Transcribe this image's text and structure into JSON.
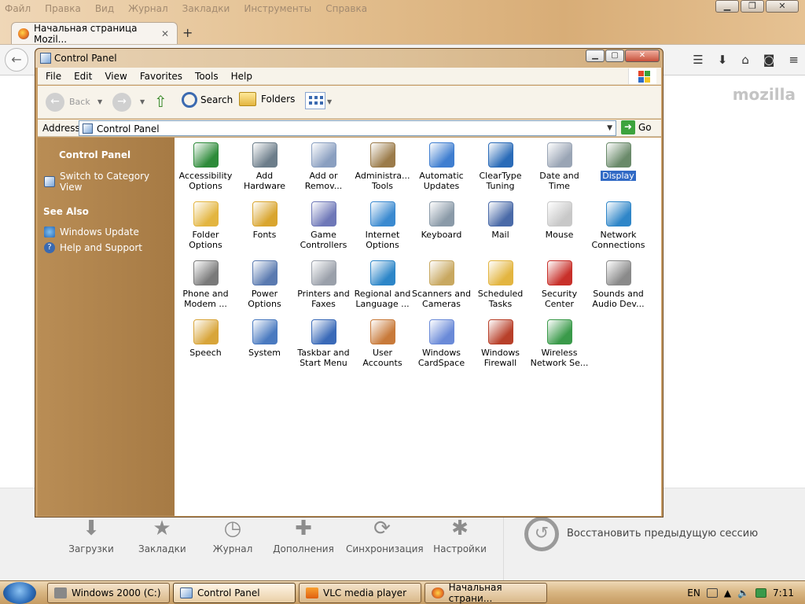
{
  "firefox": {
    "menu": [
      "Файл",
      "Правка",
      "Вид",
      "Журнал",
      "Закладки",
      "Инструменты",
      "Справка"
    ],
    "tab_title": "Начальная страница Mozil...",
    "logo": "mozilla",
    "launch": [
      {
        "label": "Загрузки",
        "icon": "download-icon"
      },
      {
        "label": "Закладки",
        "icon": "star-icon"
      },
      {
        "label": "Журнал",
        "icon": "clock-icon"
      },
      {
        "label": "Дополнения",
        "icon": "puzzle-icon"
      },
      {
        "label": "Синхронизация",
        "icon": "sync-icon"
      },
      {
        "label": "Настройки",
        "icon": "gear-icon"
      }
    ],
    "restore_session": "Восстановить предыдущую сессию"
  },
  "control_panel": {
    "title": "Control Panel",
    "menu": [
      "File",
      "Edit",
      "View",
      "Favorites",
      "Tools",
      "Help"
    ],
    "toolbar": {
      "back": "Back",
      "search": "Search",
      "folders": "Folders"
    },
    "address": {
      "label": "Address",
      "value": "Control Panel",
      "go": "Go"
    },
    "sidebar": {
      "heading": "Control Panel",
      "switch_view": "Switch to Category View",
      "see_also": "See Also",
      "links": [
        "Windows Update",
        "Help and Support"
      ]
    },
    "items": [
      {
        "line1": "Accessibility",
        "line2": "Options",
        "color": "#2e8b3a"
      },
      {
        "line1": "Add",
        "line2": "Hardware",
        "color": "#6c7d8a"
      },
      {
        "line1": "Add or",
        "line2": "Remov...",
        "color": "#8a9fc0"
      },
      {
        "line1": "Administra...",
        "line2": "Tools",
        "color": "#9b7b4a"
      },
      {
        "line1": "Automatic",
        "line2": "Updates",
        "color": "#3f7ed0"
      },
      {
        "line1": "ClearType",
        "line2": "Tuning",
        "color": "#2a6bb8"
      },
      {
        "line1": "Date and",
        "line2": "Time",
        "color": "#9aa5b5"
      },
      {
        "line1": "Display",
        "line2": "",
        "color": "#6a8a6a"
      },
      {
        "line1": "Folder",
        "line2": "Options",
        "color": "#e3b540"
      },
      {
        "line1": "Fonts",
        "line2": "",
        "color": "#d9a52e"
      },
      {
        "line1": "Game",
        "line2": "Controllers",
        "color": "#6f78b8"
      },
      {
        "line1": "Internet",
        "line2": "Options",
        "color": "#3b8ad0"
      },
      {
        "line1": "Keyboard",
        "line2": "",
        "color": "#8a9aa8"
      },
      {
        "line1": "Mail",
        "line2": "",
        "color": "#4a6aa8"
      },
      {
        "line1": "Mouse",
        "line2": "",
        "color": "#c8c8c8"
      },
      {
        "line1": "Network",
        "line2": "Connections",
        "color": "#2f86c8"
      },
      {
        "line1": "Phone and",
        "line2": "Modem ...",
        "color": "#7a7a7a"
      },
      {
        "line1": "Power",
        "line2": "Options",
        "color": "#5a7ab0"
      },
      {
        "line1": "Printers and",
        "line2": "Faxes",
        "color": "#9aa0aa"
      },
      {
        "line1": "Regional and",
        "line2": "Language ...",
        "color": "#2d86c8"
      },
      {
        "line1": "Scanners and",
        "line2": "Cameras",
        "color": "#c8a860"
      },
      {
        "line1": "Scheduled",
        "line2": "Tasks",
        "color": "#e3b540"
      },
      {
        "line1": "Security",
        "line2": "Center",
        "color": "#c8302a"
      },
      {
        "line1": "Sounds and",
        "line2": "Audio Dev...",
        "color": "#8a8a8a"
      },
      {
        "line1": "Speech",
        "line2": "",
        "color": "#d8a53a"
      },
      {
        "line1": "System",
        "line2": "",
        "color": "#4a7ac0"
      },
      {
        "line1": "Taskbar and",
        "line2": "Start Menu",
        "color": "#3a6ab8"
      },
      {
        "line1": "User",
        "line2": "Accounts",
        "color": "#c87a3a"
      },
      {
        "line1": "Windows",
        "line2": "CardSpace",
        "color": "#6a8ad8"
      },
      {
        "line1": "Windows",
        "line2": "Firewall",
        "color": "#b8402a"
      },
      {
        "line1": "Wireless",
        "line2": "Network Se...",
        "color": "#3a9a4a"
      }
    ]
  },
  "taskbar": {
    "tasks": [
      {
        "label": "Windows 2000 (C:)"
      },
      {
        "label": "Control Panel"
      },
      {
        "label": "VLC media player"
      },
      {
        "label": "Начальная страни..."
      }
    ],
    "lang": "EN",
    "time": "7:11"
  }
}
